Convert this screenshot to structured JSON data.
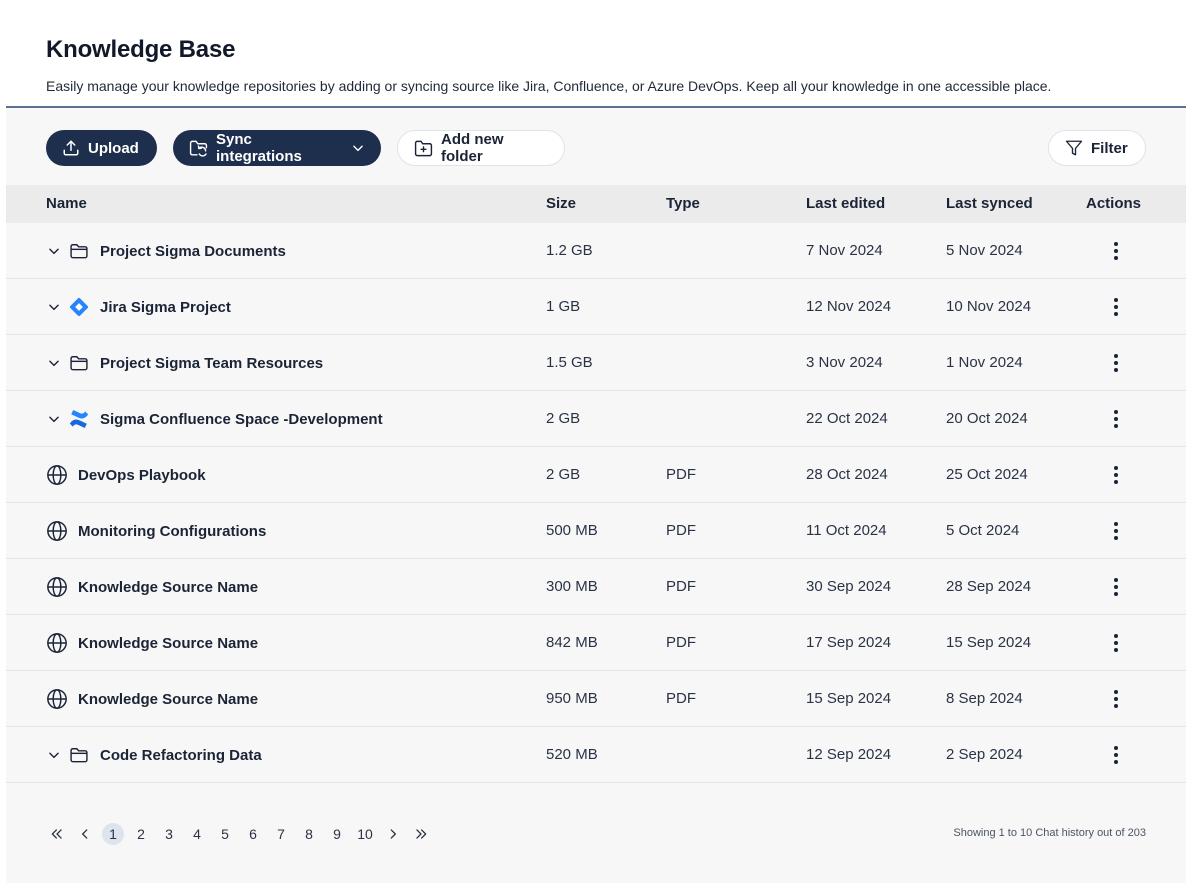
{
  "header": {
    "title": "Knowledge Base",
    "subtitle": "Easily manage your knowledge repositories by adding or syncing source like Jira, Confluence, or Azure DevOps. Keep all your knowledge in one accessible place."
  },
  "toolbar": {
    "upload_label": "Upload",
    "sync_label": "Sync integrations",
    "add_folder_label": "Add new folder",
    "filter_label": "Filter"
  },
  "table": {
    "columns": {
      "name": "Name",
      "size": "Size",
      "type": "Type",
      "last_edited": "Last edited",
      "last_synced": "Last synced",
      "actions": "Actions"
    },
    "rows": [
      {
        "name": "Project Sigma Documents",
        "size": "1.2 GB",
        "type": "",
        "last_edited": "7 Nov  2024",
        "last_synced": "5 Nov 2024",
        "icon": "folder-icon",
        "expandable": true
      },
      {
        "name": "Jira Sigma Project",
        "size": "1 GB",
        "type": "",
        "last_edited": "12 Nov 2024",
        "last_synced": "10 Nov 2024",
        "icon": "jira-icon",
        "expandable": true
      },
      {
        "name": "Project Sigma Team Resources",
        "size": "1.5 GB",
        "type": "",
        "last_edited": "3 Nov 2024",
        "last_synced": "1 Nov 2024",
        "icon": "folder-icon",
        "expandable": true
      },
      {
        "name": "Sigma Confluence Space -Development",
        "size": "2 GB",
        "type": "",
        "last_edited": "22 Oct 2024",
        "last_synced": "20 Oct 2024",
        "icon": "confluence-icon",
        "expandable": true
      },
      {
        "name": "DevOps Playbook",
        "size": "2 GB",
        "type": "PDF",
        "last_edited": "28 Oct 2024",
        "last_synced": "25 Oct 2024",
        "icon": "globe-icon",
        "expandable": false
      },
      {
        "name": "Monitoring Configurations",
        "size": "500 MB",
        "type": "PDF",
        "last_edited": "11 Oct 2024",
        "last_synced": "5 Oct 2024",
        "icon": "globe-icon",
        "expandable": false
      },
      {
        "name": "Knowledge Source Name",
        "size": "300 MB",
        "type": "PDF",
        "last_edited": "30 Sep 2024",
        "last_synced": "28 Sep 2024",
        "icon": "globe-icon",
        "expandable": false
      },
      {
        "name": "Knowledge Source Name",
        "size": "842 MB",
        "type": "PDF",
        "last_edited": "17 Sep 2024",
        "last_synced": "15 Sep 2024",
        "icon": "globe-icon",
        "expandable": false
      },
      {
        "name": "Knowledge Source Name",
        "size": "950 MB",
        "type": "PDF",
        "last_edited": "15 Sep 2024",
        "last_synced": "8 Sep 2024",
        "icon": "globe-icon",
        "expandable": false
      },
      {
        "name": "Code Refactoring Data",
        "size": "520 MB",
        "type": "",
        "last_edited": "12 Sep 2024",
        "last_synced": "2 Sep 2024",
        "icon": "folder-icon",
        "expandable": true
      }
    ]
  },
  "pagination": {
    "pages": [
      "1",
      "2",
      "3",
      "4",
      "5",
      "6",
      "7",
      "8",
      "9",
      "10"
    ],
    "current": "1",
    "showing_text": "Showing 1 to 10 Chat history out of 203"
  },
  "colors": {
    "primary_dark": "#1e2f4e",
    "jira_blue": "#2684ff",
    "confluence_blue": "#1868db",
    "active_page_bg": "#dce4ee"
  }
}
